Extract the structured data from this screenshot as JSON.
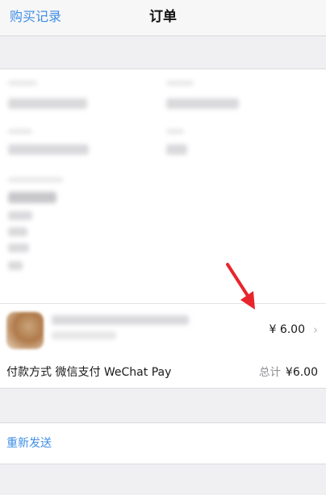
{
  "nav": {
    "back_label": "购买记录",
    "title": "订单"
  },
  "item": {
    "price": "¥ 6.00",
    "chevron": "›"
  },
  "payment": {
    "label": "付款方式 微信支付 WeChat Pay",
    "total_label": "总计",
    "total_value": "¥6.00"
  },
  "actions": {
    "resend_label": "重新发送"
  },
  "colors": {
    "accent": "#3f8ee6",
    "annotation_arrow": "#e8252b"
  }
}
